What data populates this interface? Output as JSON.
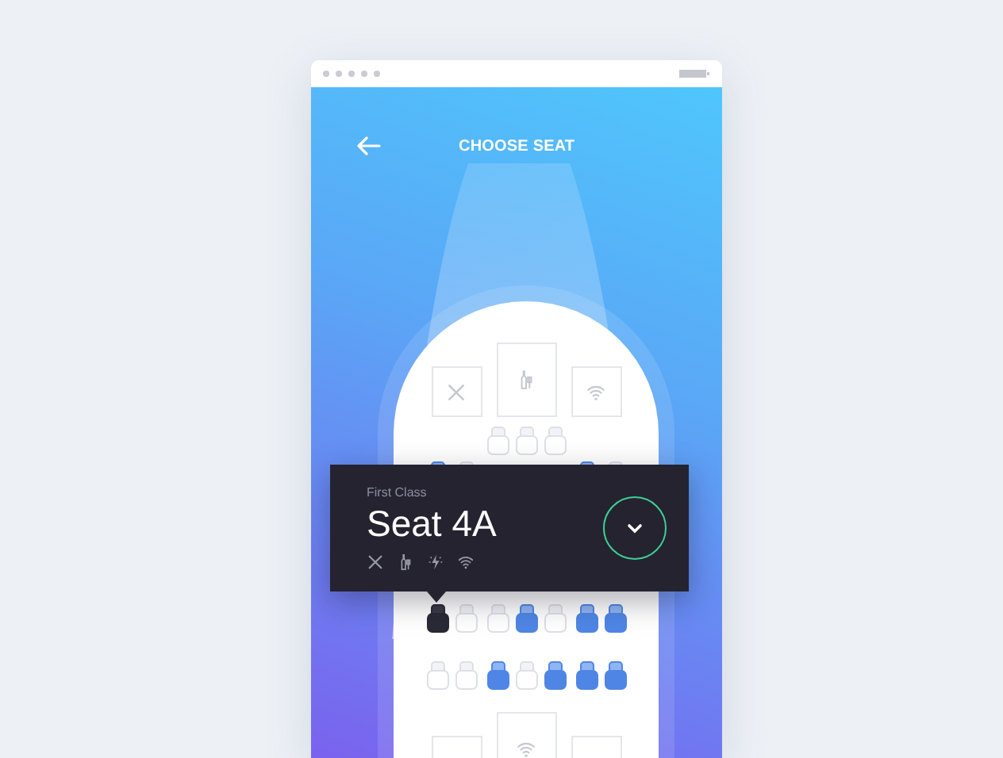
{
  "screen": {
    "title": "CHOOSE SEAT"
  },
  "amenities_front": [
    {
      "kind": "food"
    },
    {
      "kind": "drinks"
    },
    {
      "kind": "wifi"
    }
  ],
  "seat_rows": [
    {
      "left": [],
      "center": [
        {
          "available": false,
          "selected": false
        },
        {
          "available": false,
          "selected": false
        },
        {
          "available": false,
          "selected": false
        }
      ],
      "right": []
    },
    {
      "left": [
        {
          "available": true,
          "selected": false
        },
        {
          "available": false,
          "selected": false
        }
      ],
      "center": [],
      "right": [
        {
          "available": true,
          "selected": false
        },
        {
          "available": false,
          "selected": false
        }
      ]
    },
    {
      "left": [
        {
          "available": false,
          "selected": true
        },
        {
          "available": false,
          "selected": false
        }
      ],
      "center": [
        {
          "available": false,
          "selected": false
        },
        {
          "available": true,
          "selected": false
        },
        {
          "available": false,
          "selected": false
        }
      ],
      "right": [
        {
          "available": true,
          "selected": false
        },
        {
          "available": true,
          "selected": false
        }
      ]
    },
    {
      "left": [
        {
          "available": false,
          "selected": false
        },
        {
          "available": false,
          "selected": false
        }
      ],
      "center": [
        {
          "available": true,
          "selected": false
        },
        {
          "available": false,
          "selected": false
        },
        {
          "available": true,
          "selected": false
        }
      ],
      "right": [
        {
          "available": true,
          "selected": false
        },
        {
          "available": true,
          "selected": false
        }
      ]
    }
  ],
  "amenities_back": [
    {
      "kind": "blank"
    },
    {
      "kind": "wifi"
    },
    {
      "kind": "blank"
    }
  ],
  "seat_card": {
    "class_label": "First Class",
    "seat_label": "Seat 4A",
    "features": [
      {
        "kind": "food"
      },
      {
        "kind": "drinks"
      },
      {
        "kind": "power"
      },
      {
        "kind": "wifi"
      }
    ]
  }
}
